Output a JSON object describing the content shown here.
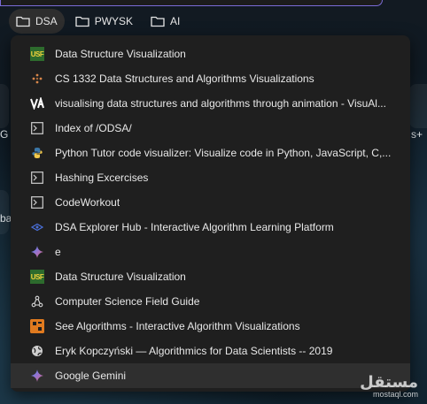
{
  "bookmarks_bar": {
    "folders": [
      {
        "label": "DSA",
        "active": true
      },
      {
        "label": "PWYSK",
        "active": false
      },
      {
        "label": "AI",
        "active": false
      }
    ]
  },
  "background": {
    "text_g": "G r",
    "text_s": "s+",
    "text_ba": "ba"
  },
  "dropdown": {
    "items": [
      {
        "label": "Data Structure Visualization",
        "icon": "usf-icon"
      },
      {
        "label": "CS 1332 Data Structures and Algorithms Visualizations",
        "icon": "dots-icon"
      },
      {
        "label": "visualising data structures and algorithms through animation - VisuAl...",
        "icon": "visualgo-icon"
      },
      {
        "label": "Index of /ODSA/",
        "icon": "terminal-icon"
      },
      {
        "label": "Python Tutor code visualizer: Visualize code in Python, JavaScript, C,...",
        "icon": "python-icon"
      },
      {
        "label": "Hashing Excercises",
        "icon": "terminal-icon"
      },
      {
        "label": "CodeWorkout",
        "icon": "terminal-icon"
      },
      {
        "label": "DSA Explorer Hub - Interactive Algorithm Learning Platform",
        "icon": "explorer-icon"
      },
      {
        "label": "e",
        "icon": "gemini-icon"
      },
      {
        "label": "Data Structure Visualization",
        "icon": "usf-icon"
      },
      {
        "label": "Computer Science Field Guide",
        "icon": "csfg-icon"
      },
      {
        "label": "See Algorithms - Interactive Algorithm Visualizations",
        "icon": "see-algorithms-icon"
      },
      {
        "label": "Eryk Kopczyński — Algorithmics for Data Scientists -- 2019",
        "icon": "globe-icon"
      },
      {
        "label": "Google Gemini",
        "icon": "gemini-icon"
      }
    ],
    "hovered_index": 13
  },
  "watermark": {
    "arabic": "مستقل",
    "latin": "mostaql.com"
  },
  "colors": {
    "dropdown_bg": "#1f1f1f",
    "hover_bg": "#2f2f2f",
    "text": "#e8e8e8",
    "address_border": "#7a6bd6"
  }
}
